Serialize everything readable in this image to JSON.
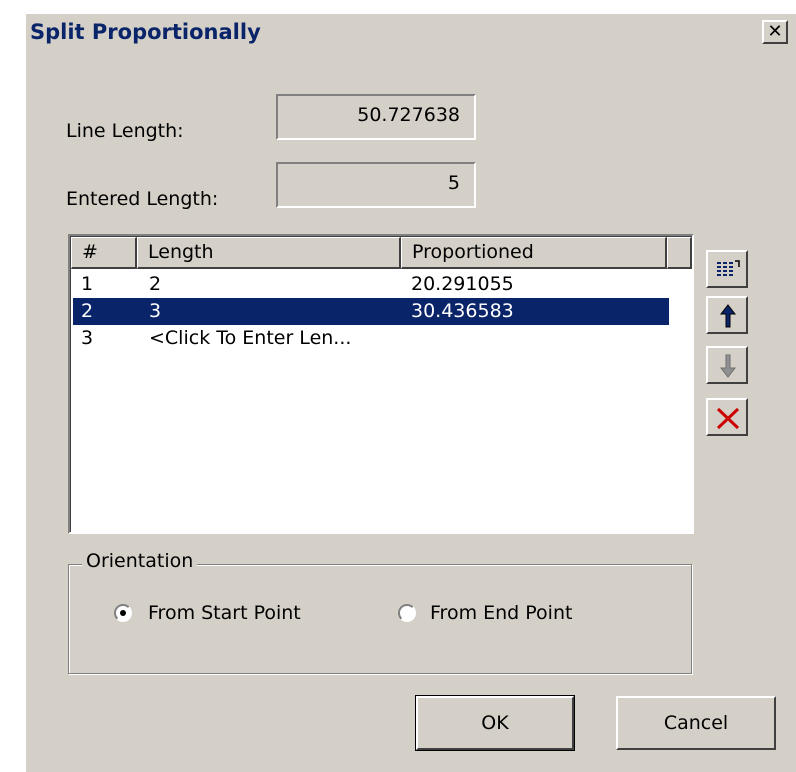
{
  "window": {
    "title": "Split Proportionally",
    "close_glyph": "✕"
  },
  "fields": {
    "line_length_label": "Line Length:",
    "line_length_value": "50.727638",
    "entered_length_label": "Entered Length:",
    "entered_length_value": "5"
  },
  "table": {
    "headers": [
      "#",
      "Length",
      "Proportioned"
    ],
    "rows": [
      {
        "num": "1",
        "length": "2",
        "proportioned": "20.291055",
        "selected": false
      },
      {
        "num": "2",
        "length": "3",
        "proportioned": "30.436583",
        "selected": true
      },
      {
        "num": "3",
        "length": "<Click To Enter Len...",
        "proportioned": "",
        "selected": false
      }
    ]
  },
  "side_buttons": [
    {
      "icon": "list-icon"
    },
    {
      "icon": "arrow-up-icon"
    },
    {
      "icon": "arrow-down-icon"
    },
    {
      "icon": "delete-x-icon"
    }
  ],
  "orientation": {
    "legend": "Orientation",
    "options": [
      {
        "label": "From Start Point",
        "checked": true
      },
      {
        "label": "From End Point",
        "checked": false
      }
    ]
  },
  "buttons": {
    "ok": "OK",
    "cancel": "Cancel"
  },
  "colors": {
    "title_text": "#0a246a",
    "selection": "#0a246a",
    "dialog_bg": "#d4d0c8",
    "delete_red": "#cc0000"
  }
}
